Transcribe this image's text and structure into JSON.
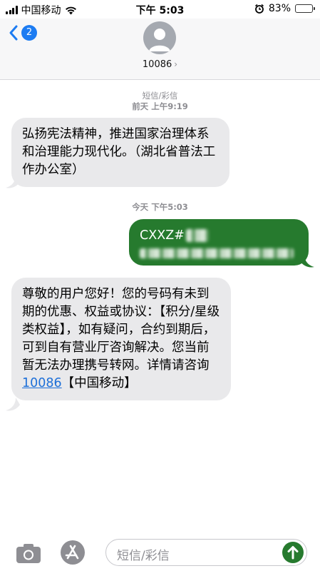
{
  "status_bar": {
    "carrier": "中国移动",
    "time": "下午 5:03",
    "battery": "83%",
    "battery_level": 0.83
  },
  "header": {
    "back_badge": "2",
    "contact_name": "10086",
    "chevron": "›"
  },
  "thread": {
    "label1": "短信/彩信",
    "time1": "前天 上午9:19",
    "message1": "弘扬宪法精神，推进国家治理体系和治理能力现代化。（湖北省普法工作办公室）",
    "time2": "今天 下午5:03",
    "outgoing_prefix": "CXXZ#",
    "message2": "尊敬的用户您好！您的号码有未到期的优惠、权益或协议：【积分/星级类权益】，如有疑问，合约到期后，可到自有营业厅咨询解决。您当前暂无法办理携号转网。详情请咨询",
    "message2_link": "10086",
    "message2_suffix": "【中国移动】"
  },
  "input_bar": {
    "placeholder": "短信/彩信"
  },
  "colors": {
    "accent": "#1d7cf2",
    "outgoing_bubble": "#267a2e",
    "incoming_bubble": "#e9e9eb",
    "link": "#1d6fd8"
  },
  "icons": [
    "signal-icon",
    "wifi-icon",
    "alarm-icon",
    "battery-icon",
    "back-chevron-icon",
    "avatar-icon",
    "camera-icon",
    "app-store-icon",
    "send-arrow-icon"
  ]
}
